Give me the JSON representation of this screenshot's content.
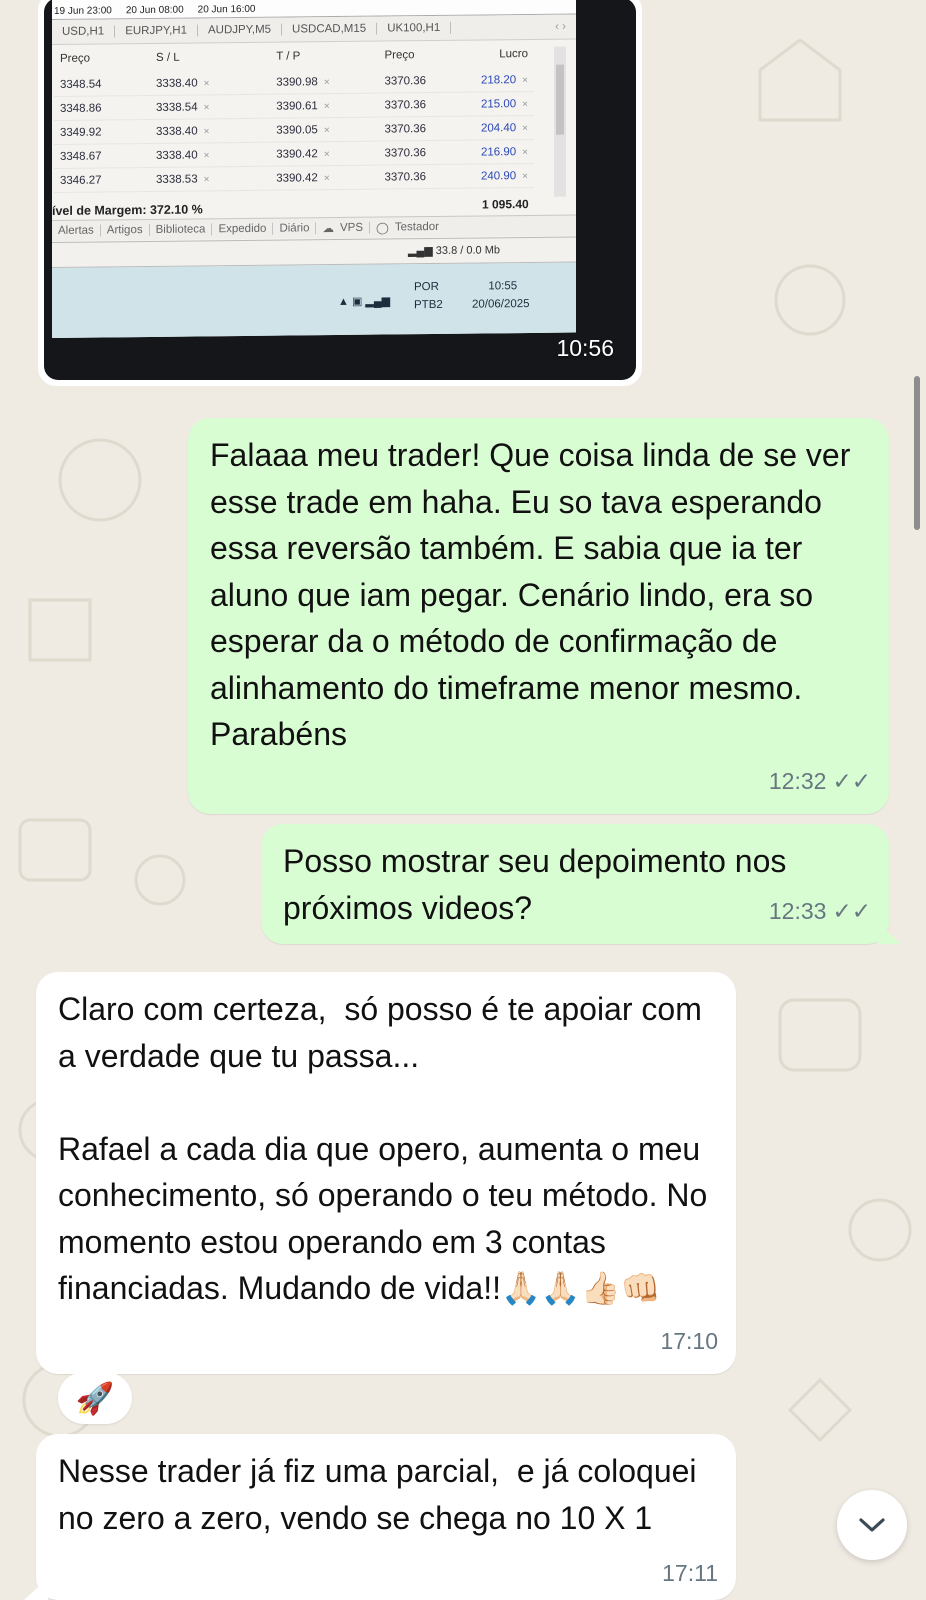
{
  "image_message": {
    "time": "10:56",
    "screenshot": {
      "axis_times": [
        "19 Jun 23:00",
        "20 Jun 08:00",
        "20 Jun 16:00"
      ],
      "chart_tabs": [
        "USD,H1",
        "EURJPY,H1",
        "AUDJPY,M5",
        "USDCAD,M15",
        "UK100,H1"
      ],
      "columns": [
        "Preço",
        "S / L",
        "T / P",
        "Preço",
        "Lucro"
      ],
      "rows": [
        {
          "price": "3348.54",
          "sl": "3338.40",
          "tp": "3390.98",
          "current": "3370.36",
          "profit": "218.20"
        },
        {
          "price": "3348.86",
          "sl": "3338.54",
          "tp": "3390.61",
          "current": "3370.36",
          "profit": "215.00"
        },
        {
          "price": "3349.92",
          "sl": "3338.40",
          "tp": "3390.05",
          "current": "3370.36",
          "profit": "204.40"
        },
        {
          "price": "3348.67",
          "sl": "3338.40",
          "tp": "3390.42",
          "current": "3370.36",
          "profit": "216.90"
        },
        {
          "price": "3346.27",
          "sl": "3338.53",
          "tp": "3390.42",
          "current": "3370.36",
          "profit": "240.90"
        }
      ],
      "margin_level": "ível de Margem: 372.10 %",
      "total_profit": "1 095.40",
      "tool_tabs": [
        "Alertas",
        "Artigos",
        "Biblioteca",
        "Expedido",
        "Diário",
        "VPS",
        "Testador"
      ],
      "network": "33.8 / 0.0 Mb",
      "lang_top": "POR",
      "lang_bottom": "PTB2",
      "clock_time": "10:55",
      "clock_date": "20/06/2025"
    }
  },
  "messages": [
    {
      "direction": "outgoing",
      "text": "Falaaa meu trader! Que coisa linda de se ver esse trade em haha. Eu so tava esperando essa reversão também. E sabia que ia ter aluno que iam pegar. Cenário lindo, era so esperar da o método de confirmação de alinhamento do timeframe menor mesmo. Parabéns",
      "time": "12:32",
      "status": "read"
    },
    {
      "direction": "outgoing",
      "text": "Posso mostrar seu depoimento nos próximos videos?",
      "time": "12:33",
      "status": "read"
    },
    {
      "direction": "incoming",
      "text": "Claro com certeza,  só posso é te apoiar com a verdade que tu passa...\n\nRafael a cada dia que opero, aumenta o meu conhecimento, só operando o teu método. No momento estou operando em 3 contas financiadas. Mudando de vida!!🙏🏻🙏🏻👍🏻👊🏻",
      "time": "17:10",
      "reaction": "🚀"
    },
    {
      "direction": "incoming",
      "text": "Nesse trader já fiz uma parcial,  e já coloquei no zero a zero, vendo se chega no 10 X 1",
      "time": "17:11"
    }
  ],
  "read_ticks": "✓✓",
  "colors": {
    "chat_background": "#efeae2",
    "outgoing_bubble": "#d9fdd3",
    "incoming_bubble": "#ffffff",
    "meta_text": "#667781"
  }
}
